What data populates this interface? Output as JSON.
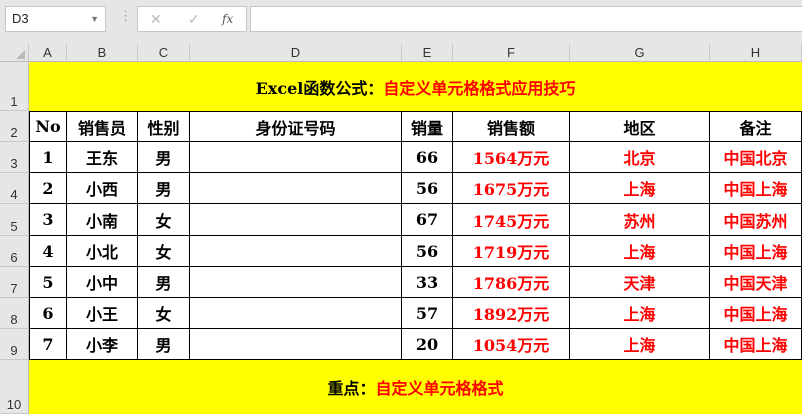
{
  "formula_bar": {
    "name_box": "D3",
    "cancel": "✕",
    "enter": "✓",
    "fx": "fx",
    "formula": ""
  },
  "columns": [
    "A",
    "B",
    "C",
    "D",
    "E",
    "F",
    "G",
    "H"
  ],
  "rows": [
    "1",
    "2",
    "3",
    "4",
    "5",
    "6",
    "7",
    "8",
    "9",
    "10"
  ],
  "title": {
    "black": "Excel函数公式：",
    "red": "自定义单元格格式应用技巧"
  },
  "headers": [
    "No",
    "销售员",
    "性别",
    "身份证号码",
    "销量",
    "销售额",
    "地区",
    "备注"
  ],
  "data": [
    [
      "1",
      "王东",
      "男",
      "",
      "66",
      "1564万元",
      "北京",
      "中国北京"
    ],
    [
      "2",
      "小西",
      "男",
      "",
      "56",
      "1675万元",
      "上海",
      "中国上海"
    ],
    [
      "3",
      "小南",
      "女",
      "",
      "67",
      "1745万元",
      "苏州",
      "中国苏州"
    ],
    [
      "4",
      "小北",
      "女",
      "",
      "56",
      "1719万元",
      "上海",
      "中国上海"
    ],
    [
      "5",
      "小中",
      "男",
      "",
      "33",
      "1786万元",
      "天津",
      "中国天津"
    ],
    [
      "6",
      "小王",
      "女",
      "",
      "57",
      "1892万元",
      "上海",
      "中国上海"
    ],
    [
      "7",
      "小李",
      "男",
      "",
      "20",
      "1054万元",
      "上海",
      "中国上海"
    ]
  ],
  "footer": {
    "black": "重点：",
    "red": "自定义单元格格式"
  }
}
